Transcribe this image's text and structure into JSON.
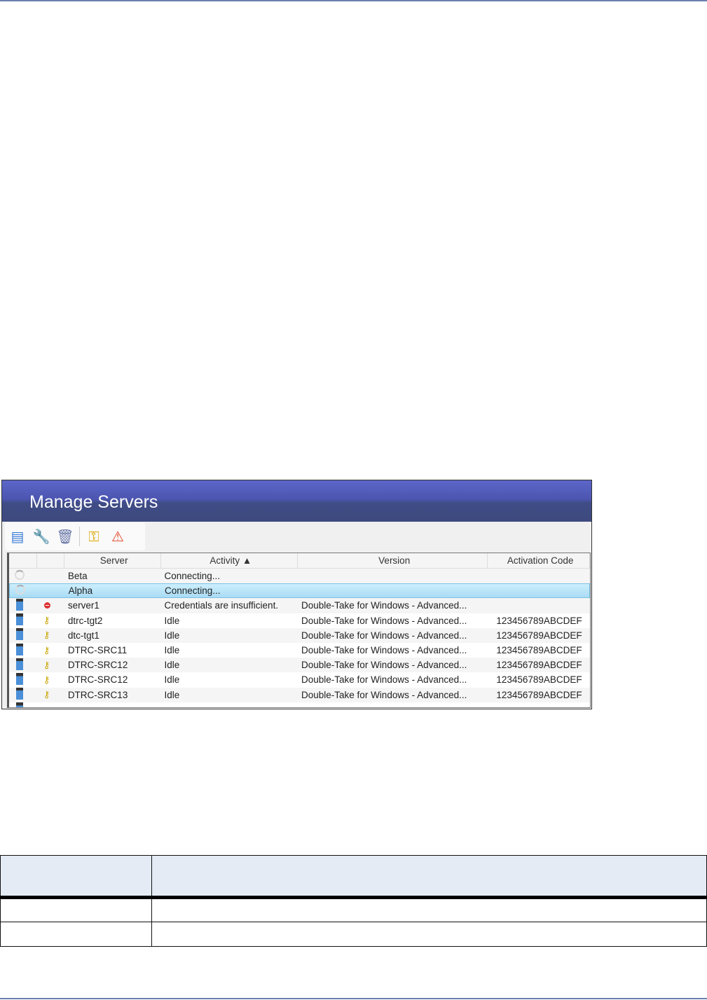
{
  "window": {
    "title": "Manage Servers"
  },
  "toolbar": [
    {
      "name": "add-server",
      "icon": "server-add-icon"
    },
    {
      "name": "provide-credentials",
      "icon": "wrench-icon"
    },
    {
      "name": "remove-server",
      "icon": "trash-icon"
    },
    {
      "name": "manage-licenses",
      "icon": "keys-icon"
    },
    {
      "name": "view-server-events",
      "icon": "events-icon"
    }
  ],
  "grid": {
    "columns": [
      "",
      "",
      "Server",
      "Activity ▲",
      "Version",
      "Activation Code"
    ],
    "rows": [
      {
        "status": "connecting",
        "key": "",
        "server": "Beta",
        "activity": "Connecting...",
        "version": "",
        "code": ""
      },
      {
        "status": "connecting",
        "key": "",
        "server": "Alpha",
        "activity": "Connecting...",
        "version": "",
        "code": "",
        "selected": true
      },
      {
        "status": "server",
        "key": "error",
        "server": "server1",
        "activity": "Credentials are insufficient.",
        "version": "Double-Take for Windows - Advanced...",
        "code": ""
      },
      {
        "status": "server",
        "key": "key",
        "server": "dtrc-tgt2",
        "activity": "Idle",
        "version": "Double-Take for Windows - Advanced...",
        "code": "123456789ABCDEF"
      },
      {
        "status": "server",
        "key": "key",
        "server": "dtc-tgt1",
        "activity": "Idle",
        "version": "Double-Take for Windows - Advanced...",
        "code": "123456789ABCDEF"
      },
      {
        "status": "server",
        "key": "key",
        "server": "DTRC-SRC11",
        "activity": "Idle",
        "version": "Double-Take for Windows - Advanced...",
        "code": "123456789ABCDEF"
      },
      {
        "status": "server",
        "key": "key",
        "server": "DTRC-SRC12",
        "activity": "Idle",
        "version": "Double-Take for Windows - Advanced...",
        "code": "123456789ABCDEF"
      },
      {
        "status": "server",
        "key": "key",
        "server": "DTRC-SRC12",
        "activity": "Idle",
        "version": "Double-Take for Windows - Advanced...",
        "code": "123456789ABCDEF"
      },
      {
        "status": "server",
        "key": "key",
        "server": "DTRC-SRC13",
        "activity": "Idle",
        "version": "Double-Take for Windows - Advanced...",
        "code": "123456789ABCDEF"
      }
    ]
  },
  "colors": {
    "title_bar": "#4c56b0",
    "selected_row": "#a9dcf5",
    "table_header": "#e4ebf4",
    "rule": "#6a7fb0"
  }
}
